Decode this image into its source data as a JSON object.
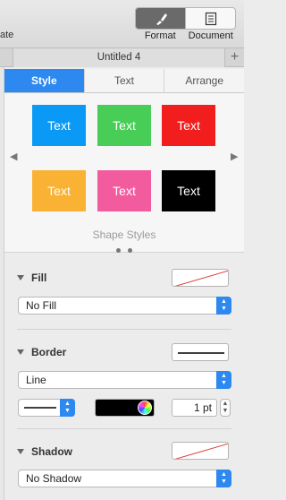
{
  "toolbar": {
    "left_partial_label": "ate",
    "format_label": "Format",
    "document_label": "Document"
  },
  "tabstrip": {
    "doc_title": "Untitled 4",
    "add_tab_glyph": "+"
  },
  "inspector": {
    "tabs": [
      {
        "label": "Style",
        "active": true
      },
      {
        "label": "Text",
        "active": false
      },
      {
        "label": "Arrange",
        "active": false
      }
    ],
    "shape_styles": {
      "caption": "Shape Styles",
      "swatches": [
        {
          "label": "Text",
          "color": "#0a9af5"
        },
        {
          "label": "Text",
          "color": "#48cd57"
        },
        {
          "label": "Text",
          "color": "#f21e1e"
        },
        {
          "label": "Text",
          "color": "#f9b233"
        },
        {
          "label": "Text",
          "color": "#f25c9f"
        },
        {
          "label": "Text",
          "color": "#000000"
        }
      ],
      "left_arrow": "◀",
      "right_arrow": "▶"
    },
    "fill": {
      "label": "Fill",
      "popup_value": "No Fill"
    },
    "border": {
      "label": "Border",
      "popup_value": "Line",
      "width_value": "1 pt",
      "color": "#000000"
    },
    "shadow": {
      "label": "Shadow",
      "popup_value": "No Shadow"
    },
    "accent_color": "#2d88f0"
  }
}
